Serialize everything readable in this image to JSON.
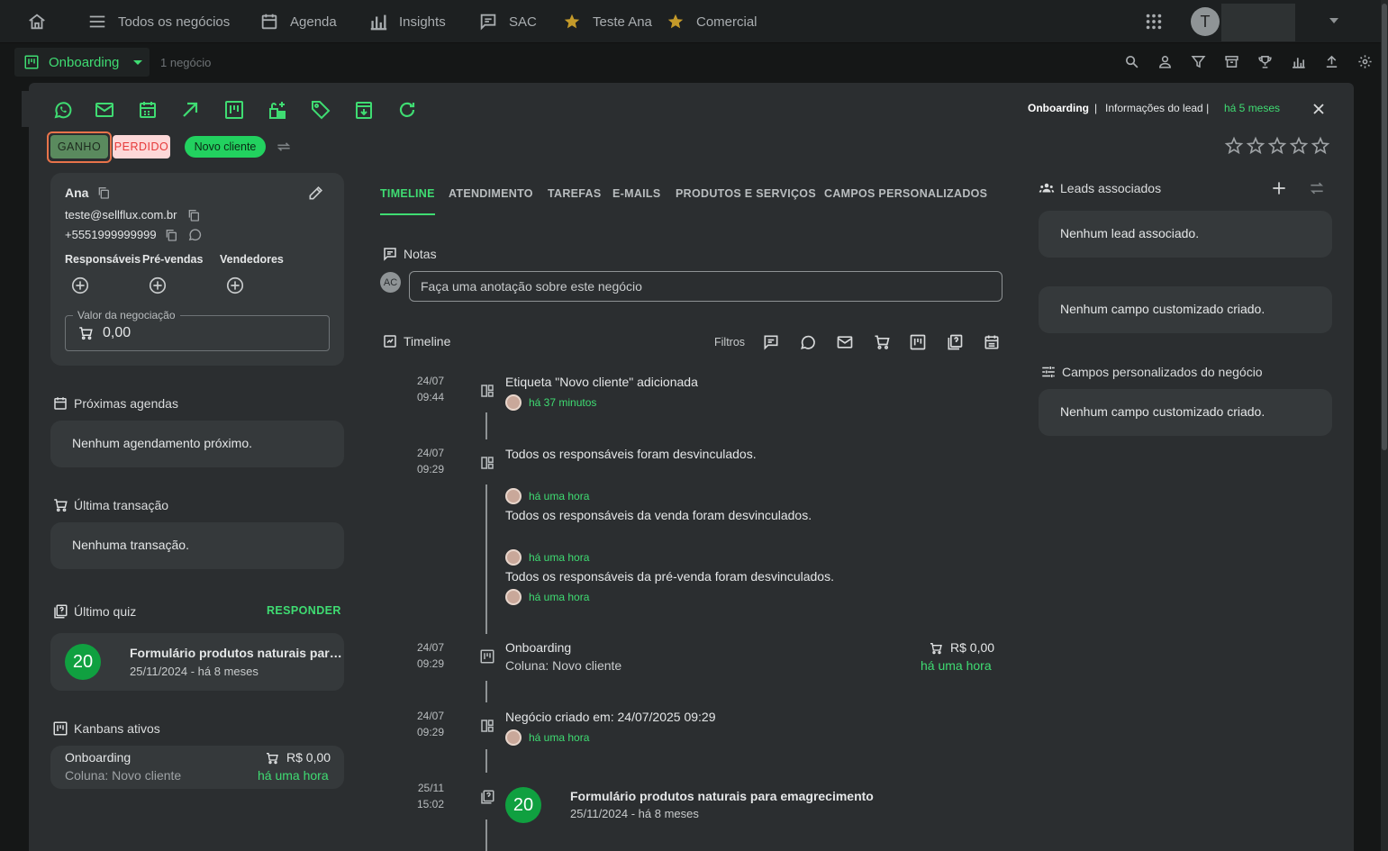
{
  "nav": {
    "items": [
      "Todos os negócios",
      "Agenda",
      "Insights",
      "SAC",
      "Teste Ana",
      "Comercial"
    ],
    "avatar_initial": "T"
  },
  "subbar": {
    "pipeline": "Onboarding",
    "count": "1 negócio"
  },
  "header": {
    "pipeline": "Onboarding",
    "separator": "|",
    "info": "Informações do lead |",
    "ago": "há 5 meses"
  },
  "tags": {
    "won": "GANHO",
    "lost": "PERDIDO",
    "label": "Novo cliente"
  },
  "contact": {
    "name": "Ana",
    "email": "teste@sellflux.com.br",
    "phone": "+5551999999999",
    "roles": [
      "Responsáveis",
      "Pré-vendas",
      "Vendedores"
    ],
    "value_label": "Valor da negociação",
    "value": "0,00"
  },
  "left": {
    "agendas_title": "Próximas agendas",
    "agendas_empty": "Nenhum agendamento próximo.",
    "transaction_title": "Última transação",
    "transaction_empty": "Nenhuma transação.",
    "quiz_title": "Último quiz",
    "quiz_action": "RESPONDER",
    "quiz": {
      "score": "20",
      "name": "Formulário produtos naturais par…",
      "date": "25/11/2024 - há 8 meses"
    },
    "kanban_title": "Kanbans ativos",
    "kanban": {
      "name": "Onboarding",
      "column": "Coluna: Novo cliente",
      "value": "R$ 0,00",
      "ago": "há uma hora"
    }
  },
  "tabs": [
    "TIMELINE",
    "ATENDIMENTO",
    "TAREFAS",
    "E-MAILS",
    "PRODUTOS E SERVIÇOS",
    "CAMPOS PERSONALIZADOS"
  ],
  "notes": {
    "title": "Notas",
    "avatar": "AC",
    "placeholder": "Faça uma anotação sobre este negócio"
  },
  "timeline": {
    "title": "Timeline",
    "filters": "Filtros",
    "e1": {
      "d": "24/07",
      "t": "09:44",
      "text": "Etiqueta \"Novo cliente\" adicionada",
      "ago": "há 37 minutos"
    },
    "e2": {
      "d": "24/07",
      "t": "09:29",
      "text": "Todos os responsáveis foram desvinculados.",
      "ago1": "há uma hora",
      "sub1": "Todos os responsáveis da venda foram desvinculados.",
      "ago2": "há uma hora",
      "sub2": "Todos os responsáveis da pré-venda foram desvinculados.",
      "ago3": "há uma hora"
    },
    "e3": {
      "d": "24/07",
      "t": "09:29",
      "name": "Onboarding",
      "column": "Coluna: Novo cliente",
      "value": "R$ 0,00",
      "ago": "há uma hora"
    },
    "e4": {
      "d": "24/07",
      "t": "09:29",
      "text": "Negócio criado em: 24/07/2025 09:29",
      "ago": "há uma hora"
    },
    "e5": {
      "d": "25/11",
      "t": "15:02",
      "score": "20",
      "name": "Formulário produtos naturais para emagrecimento",
      "date": "25/11/2024 - há 8 meses"
    }
  },
  "right": {
    "leads_title": "Leads associados",
    "leads_empty": "Nenhum lead associado.",
    "custom_empty": "Nenhum campo customizado criado.",
    "deal_fields_title": "Campos personalizados do negócio",
    "deal_fields_empty": "Nenhum campo customizado criado."
  },
  "colors": {
    "accent": "#3fdc72",
    "lost": "#ff6a6a",
    "won_bg": "#5a8a5e",
    "tag_bg": "#22d15f"
  }
}
